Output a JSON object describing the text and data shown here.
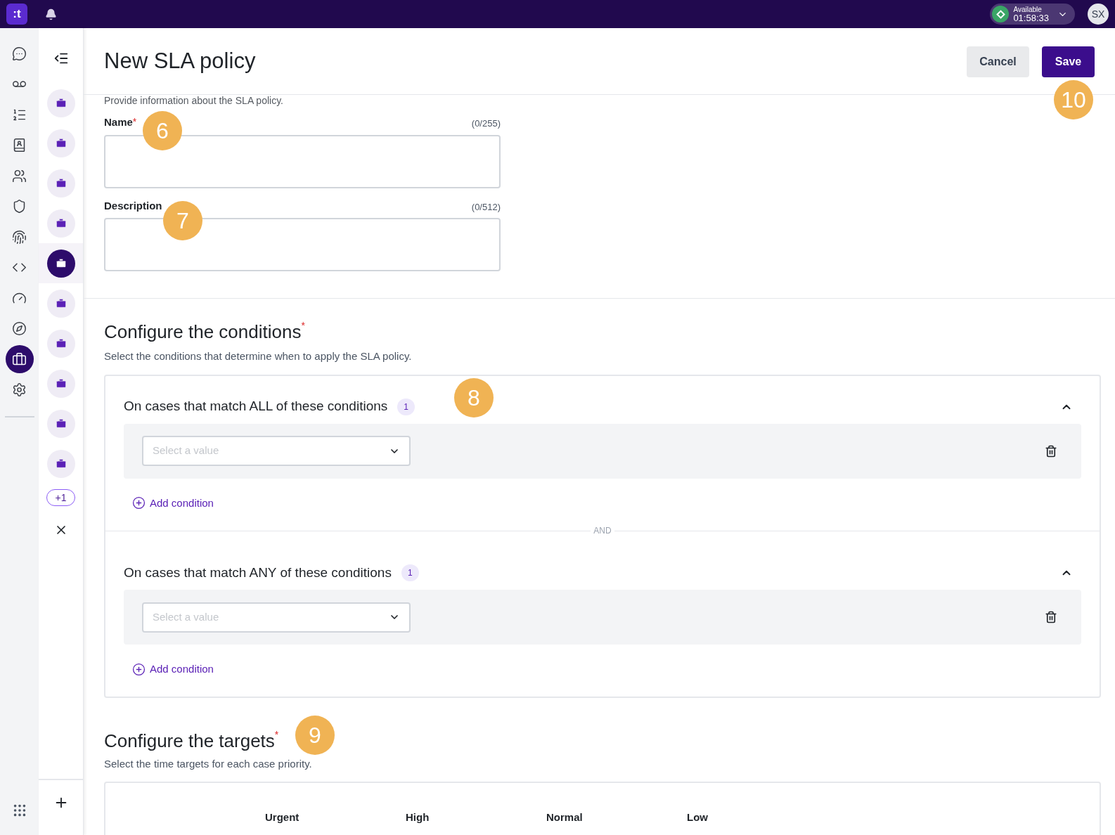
{
  "top_bar": {
    "logo": ":t",
    "status": {
      "label": "Available",
      "timer": "01:58:33",
      "online": true
    },
    "avatar": "SX"
  },
  "nav_rail": [
    {
      "selected": false
    },
    {
      "selected": false
    },
    {
      "selected": false
    },
    {
      "selected": false
    },
    {
      "selected": false
    },
    {
      "selected": false
    },
    {
      "selected": false
    },
    {
      "selected": false
    },
    {
      "selected": false
    },
    {
      "selected": false
    },
    {
      "selected": true
    },
    {
      "selected": false
    }
  ],
  "workspaces": {
    "items": [
      {
        "selected": false
      },
      {
        "selected": false
      },
      {
        "selected": false
      },
      {
        "selected": false
      },
      {
        "selected": true
      },
      {
        "selected": false
      },
      {
        "selected": false
      },
      {
        "selected": false
      },
      {
        "selected": false
      },
      {
        "selected": false
      }
    ],
    "more": "+1"
  },
  "header": {
    "title": "New SLA policy",
    "buttons": [
      {
        "label": "Cancel",
        "kind": "secondary"
      },
      {
        "label": "Save",
        "kind": "primary"
      }
    ]
  },
  "details": {
    "subtitle": "Provide information about the SLA policy.",
    "fields": [
      {
        "label": "Name",
        "required_mark": "*",
        "counter": "(0/255)"
      },
      {
        "label": "Description",
        "counter": "(0/512)"
      }
    ]
  },
  "conditions": {
    "title": "Configure the conditions",
    "required_mark": "*",
    "description": "Select the conditions that determine when to apply the SLA policy.",
    "separator": "AND",
    "groups": [
      {
        "title": "On cases that match ALL of these conditions",
        "count": "1",
        "expanded": true,
        "rows": [
          {
            "placeholder": "Select a value"
          }
        ],
        "add_label": "Add condition"
      },
      {
        "title": "On cases that match ANY of these conditions",
        "count": "1",
        "expanded": true,
        "rows": [
          {
            "placeholder": "Select a value"
          }
        ],
        "add_label": "Add condition"
      }
    ]
  },
  "targets": {
    "title": "Configure the targets",
    "required_mark": "*",
    "description": "Select the time targets for each case priority.",
    "columns": [
      "Urgent",
      "High",
      "Normal",
      "Low"
    ]
  },
  "callouts": [
    "6",
    "7",
    "8",
    "9",
    "10"
  ]
}
